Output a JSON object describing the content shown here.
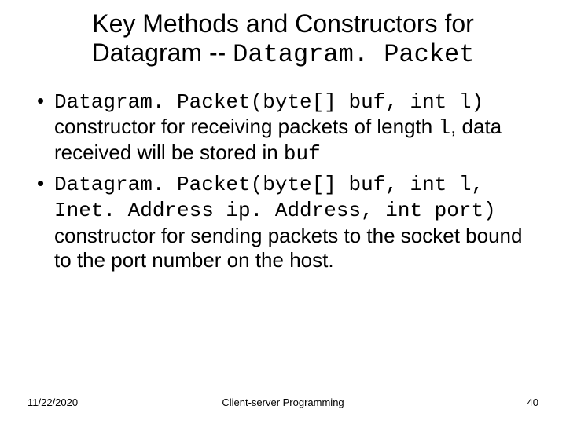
{
  "title": {
    "line1": "Key Methods and Constructors for",
    "line2_prefix": "Datagram -- ",
    "line2_code": "Datagram. Packet"
  },
  "bullets": [
    {
      "code1": "Datagram. Packet(byte[] buf, int l)",
      "text1": " constructor for receiving packets of length ",
      "code2": "l",
      "text2": ", data received will be stored in ",
      "code3": "buf"
    },
    {
      "code1": "Datagram. Packet(byte[] buf, int l, Inet. Address ip. Address, int port)",
      "text1": " constructor for sending packets to the socket bound to the port number on the host."
    }
  ],
  "footer": {
    "date": "11/22/2020",
    "center": "Client-server Programming",
    "page": "40"
  }
}
